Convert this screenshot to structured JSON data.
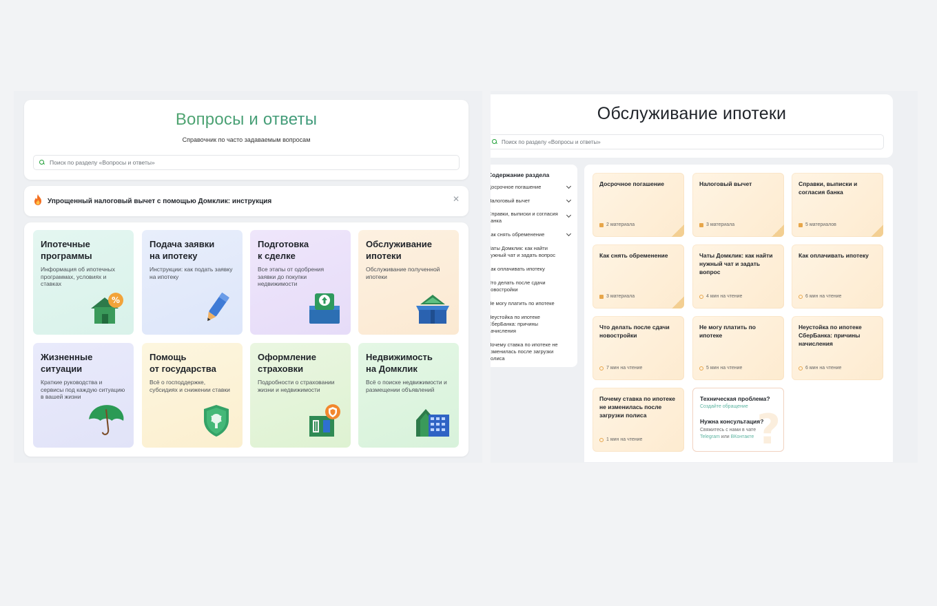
{
  "left": {
    "title": "Вопросы и ответы",
    "subtitle": "Справочник по часто задаваемым вопросам",
    "search_placeholder": "Поиск по разделу «Вопросы и ответы»",
    "banner": "Упрощенный налоговый вычет с помощью Домклик: инструкция",
    "tiles": [
      {
        "title": "Ипотечные\nпрограммы",
        "desc": "Информация об ипотечных программах, условиях и ставках"
      },
      {
        "title": "Подача заявки\nна ипотеку",
        "desc": "Инструкции: как подать заявку на ипотеку"
      },
      {
        "title": "Подготовка\nк сделке",
        "desc": "Все этапы от одобрения заявки до покупки недвижимости"
      },
      {
        "title": "Обслуживание\nипотеки",
        "desc": "Обслуживание полученной ипотеки"
      },
      {
        "title": "Жизненные\nситуации",
        "desc": "Краткие руководства и сервисы под каждую ситуацию в вашей жизни"
      },
      {
        "title": "Помощь\nот государства",
        "desc": "Всё о господдержке, субсидиях и снижении ставки"
      },
      {
        "title": "Оформление\nстраховки",
        "desc": "Подробности о страховании жизни и недвижимости"
      },
      {
        "title": "Недвижимость\nна Домклик",
        "desc": "Всё о поиске недвижимости и размещении объявлений"
      }
    ]
  },
  "right": {
    "title": "Обслуживание ипотеки",
    "search_placeholder": "Поиск по разделу «Вопросы и ответы»",
    "toc_title": "Содержание раздела",
    "toc": [
      {
        "label": "Досрочное погашение"
      },
      {
        "label": "Налоговый вычет"
      },
      {
        "label": "Справки, выписки и согласия банка"
      },
      {
        "label": "Как снять обременение"
      },
      {
        "label": "Чаты Домклик: как найти нужный чат и задать вопрос"
      },
      {
        "label": "Как оплачивать ипотеку"
      },
      {
        "label": "Что делать после сдачи новостройки"
      },
      {
        "label": "Не могу платить по ипотеке"
      },
      {
        "label": "Неустойка по ипотеке СберБанка: причины начисления"
      },
      {
        "label": "Почему ставка по ипотеке не изменилась после загрузки полиса"
      }
    ],
    "cards": [
      {
        "title": "Досрочное погашение",
        "meta": "2 материала",
        "kind": "doc"
      },
      {
        "title": "Налоговый вычет",
        "meta": "3 материала",
        "kind": "doc"
      },
      {
        "title": "Справки, выписки и согласия банка",
        "meta": "5 материалов",
        "kind": "doc"
      },
      {
        "title": "Как снять обременение",
        "meta": "3 материала",
        "kind": "doc"
      },
      {
        "title": "Чаты Домклик: как найти нужный чат и задать вопрос",
        "meta": "4 мин на чтение",
        "kind": "clock"
      },
      {
        "title": "Как оплачивать ипотеку",
        "meta": "6 мин на чтение",
        "kind": "clock"
      },
      {
        "title": "Что делать после сдачи новостройки",
        "meta": "7 мин на чтение",
        "kind": "clock"
      },
      {
        "title": "Не могу платить по ипотеке",
        "meta": "5 мин на чтение",
        "kind": "clock"
      },
      {
        "title": "Неустойка по ипотеке СберБанка: причины начисления",
        "meta": "6 мин на чтение",
        "kind": "clock"
      },
      {
        "title": "Почему ставка по ипотеке не изменилась после загрузки полиса",
        "meta": "1 мин на чтение",
        "kind": "clock"
      }
    ],
    "help": {
      "tech_title": "Техническая проблема?",
      "tech_link": "Создайте обращение",
      "consult_title": "Нужна консультация?",
      "consult_text": "Свяжитесь с нами в чате",
      "tg": "Telegram",
      "or": " или ",
      "vk": "ВКонтакте"
    }
  }
}
